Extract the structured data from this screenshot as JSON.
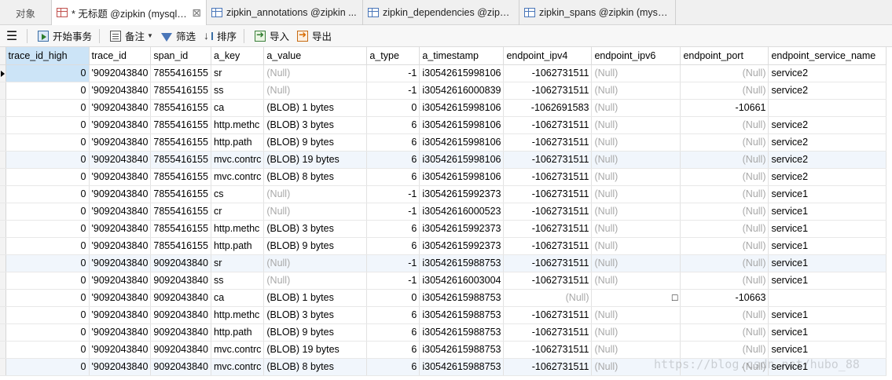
{
  "tabs": [
    {
      "label": "对象",
      "icon": "none"
    },
    {
      "label": "* 无标题 @zipkin (mysql_l...",
      "icon": "query-table-icon",
      "close": "⊠"
    },
    {
      "label": "zipkin_annotations @zipkin ...",
      "icon": "table-icon"
    },
    {
      "label": "zipkin_dependencies @zipki...",
      "icon": "table-icon"
    },
    {
      "label": "zipkin_spans @zipkin (mysq...",
      "icon": "table-icon"
    }
  ],
  "toolbar": {
    "begin_tx": "开始事务",
    "note": "备注",
    "filter": "筛选",
    "sort": "排序",
    "import": "导入",
    "export": "导出"
  },
  "columns": [
    "trace_id_high",
    "trace_id",
    "span_id",
    "a_key",
    "a_value",
    "a_type",
    "a_timestamp",
    "endpoint_ipv4",
    "endpoint_ipv6",
    "endpoint_port",
    "endpoint_service_name"
  ],
  "rows": [
    [
      "0",
      "'9092043840",
      "7855416155",
      "sr",
      "(Null)",
      "-1",
      "i30542615998106",
      "-1062731511",
      "(Null)",
      "(Null)",
      "service2"
    ],
    [
      "0",
      "'9092043840",
      "7855416155",
      "ss",
      "(Null)",
      "-1",
      "i30542616000839",
      "-1062731511",
      "(Null)",
      "(Null)",
      "service2"
    ],
    [
      "0",
      "'9092043840",
      "7855416155",
      "ca",
      "(BLOB) 1 bytes",
      "0",
      "i30542615998106",
      "-1062691583",
      "(Null)",
      "-10661",
      ""
    ],
    [
      "0",
      "'9092043840",
      "7855416155",
      "http.methc",
      "(BLOB) 3 bytes",
      "6",
      "i30542615998106",
      "-1062731511",
      "(Null)",
      "(Null)",
      "service2"
    ],
    [
      "0",
      "'9092043840",
      "7855416155",
      "http.path",
      "(BLOB) 9 bytes",
      "6",
      "i30542615998106",
      "-1062731511",
      "(Null)",
      "(Null)",
      "service2"
    ],
    [
      "0",
      "'9092043840",
      "7855416155",
      "mvc.contrc",
      "(BLOB) 19 bytes",
      "6",
      "i30542615998106",
      "-1062731511",
      "(Null)",
      "(Null)",
      "service2"
    ],
    [
      "0",
      "'9092043840",
      "7855416155",
      "mvc.contrc",
      "(BLOB) 8 bytes",
      "6",
      "i30542615998106",
      "-1062731511",
      "(Null)",
      "(Null)",
      "service2"
    ],
    [
      "0",
      "'9092043840",
      "7855416155",
      "cs",
      "(Null)",
      "-1",
      "i30542615992373",
      "-1062731511",
      "(Null)",
      "(Null)",
      "service1"
    ],
    [
      "0",
      "'9092043840",
      "7855416155",
      "cr",
      "(Null)",
      "-1",
      "i30542616000523",
      "-1062731511",
      "(Null)",
      "(Null)",
      "service1"
    ],
    [
      "0",
      "'9092043840",
      "7855416155",
      "http.methc",
      "(BLOB) 3 bytes",
      "6",
      "i30542615992373",
      "-1062731511",
      "(Null)",
      "(Null)",
      "service1"
    ],
    [
      "0",
      "'9092043840",
      "7855416155",
      "http.path",
      "(BLOB) 9 bytes",
      "6",
      "i30542615992373",
      "-1062731511",
      "(Null)",
      "(Null)",
      "service1"
    ],
    [
      "0",
      "'9092043840",
      "9092043840",
      "sr",
      "(Null)",
      "-1",
      "i30542615988753",
      "-1062731511",
      "(Null)",
      "(Null)",
      "service1"
    ],
    [
      "0",
      "'9092043840",
      "9092043840",
      "ss",
      "(Null)",
      "-1",
      "i30542616003004",
      "-1062731511",
      "(Null)",
      "(Null)",
      "service1"
    ],
    [
      "0",
      "'9092043840",
      "9092043840",
      "ca",
      "(BLOB) 1 bytes",
      "0",
      "i30542615988753",
      "(Null)",
      "□",
      "-10663",
      ""
    ],
    [
      "0",
      "'9092043840",
      "9092043840",
      "http.methc",
      "(BLOB) 3 bytes",
      "6",
      "i30542615988753",
      "-1062731511",
      "(Null)",
      "(Null)",
      "service1"
    ],
    [
      "0",
      "'9092043840",
      "9092043840",
      "http.path",
      "(BLOB) 9 bytes",
      "6",
      "i30542615988753",
      "-1062731511",
      "(Null)",
      "(Null)",
      "service1"
    ],
    [
      "0",
      "'9092043840",
      "9092043840",
      "mvc.contrc",
      "(BLOB) 19 bytes",
      "6",
      "i30542615988753",
      "-1062731511",
      "(Null)",
      "(Null)",
      "service1"
    ],
    [
      "0",
      "'9092043840",
      "9092043840",
      "mvc.contrc",
      "(BLOB) 8 bytes",
      "6",
      "i30542615988753",
      "-1062731511",
      "(Null)",
      "(Null)",
      "service1"
    ]
  ],
  "alt_rows": [
    5,
    11,
    17
  ],
  "watermark": "https://blog.csdn.net/hubo_88",
  "colors": {
    "selection": "#cce4f7",
    "null_text": "#a8a8a8",
    "alt_row": "#f1f6fc"
  }
}
